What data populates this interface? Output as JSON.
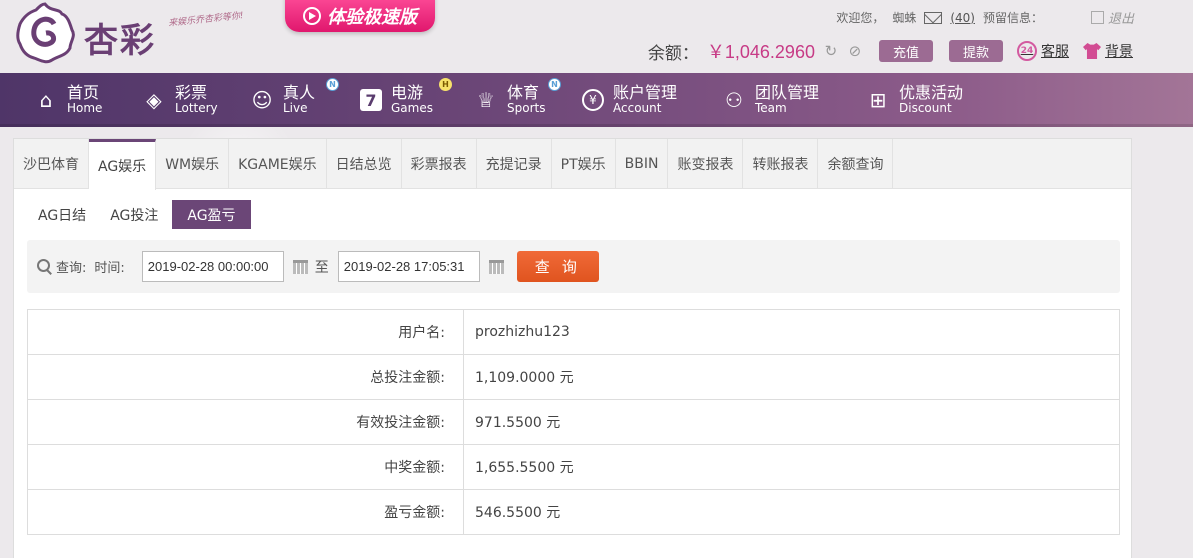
{
  "header": {
    "logo_text": "杏彩",
    "slogan": "来娱乐乔杏彩等你!",
    "promo_banner": "体验极速版",
    "welcome": "欢迎您，",
    "username": "蜘蛛",
    "mail_count": "(40)",
    "notice_label": "预留信息：",
    "logout": "退出",
    "balance_label": "余额：",
    "balance_value": "￥1,046.2960",
    "deposit": "充值",
    "withdraw": "提款",
    "service": "客服",
    "background": "背景"
  },
  "nav": [
    {
      "cn": "首页",
      "en": "Home",
      "icon": "home-icon"
    },
    {
      "cn": "彩票",
      "en": "Lottery",
      "icon": "ticket-icon"
    },
    {
      "cn": "真人",
      "en": "Live",
      "icon": "dealer-icon",
      "badge": "N"
    },
    {
      "cn": "电游",
      "en": "Games",
      "icon": "seven-icon",
      "badge": "H"
    },
    {
      "cn": "体育",
      "en": "Sports",
      "icon": "trophy-icon",
      "badge": "N"
    },
    {
      "cn": "账户管理",
      "en": "Account",
      "icon": "account-icon"
    },
    {
      "cn": "团队管理",
      "en": "Team",
      "icon": "team-icon"
    },
    {
      "cn": "优惠活动",
      "en": "Discount",
      "icon": "gift-icon"
    }
  ],
  "tabs": [
    "沙巴体育",
    "AG娱乐",
    "WM娱乐",
    "KGAME娱乐",
    "日结总览",
    "彩票报表",
    "充提记录",
    "PT娱乐",
    "BBIN",
    "账变报表",
    "转账报表",
    "余额查询"
  ],
  "active_tab": "AG娱乐",
  "subtabs": [
    "AG日结",
    "AG投注",
    "AG盈亏"
  ],
  "active_subtab": "AG盈亏",
  "query": {
    "label": "查询:",
    "time_label": "时间:",
    "start": "2019-02-28 00:00:00",
    "to": "至",
    "end": "2019-02-28 17:05:31",
    "button": "查 询"
  },
  "result": [
    {
      "label": "用户名:",
      "value": "prozhizhu123"
    },
    {
      "label": "总投注金额:",
      "value": "1,109.0000 元"
    },
    {
      "label": "有效投注金额:",
      "value": "971.5500 元"
    },
    {
      "label": "中奖金额:",
      "value": "1,655.5500 元"
    },
    {
      "label": "盈亏金额:",
      "value": "546.5500 元"
    }
  ],
  "colors": {
    "brand": "#6b4677",
    "accent": "#c73b86",
    "query_button": "#e8602b"
  }
}
